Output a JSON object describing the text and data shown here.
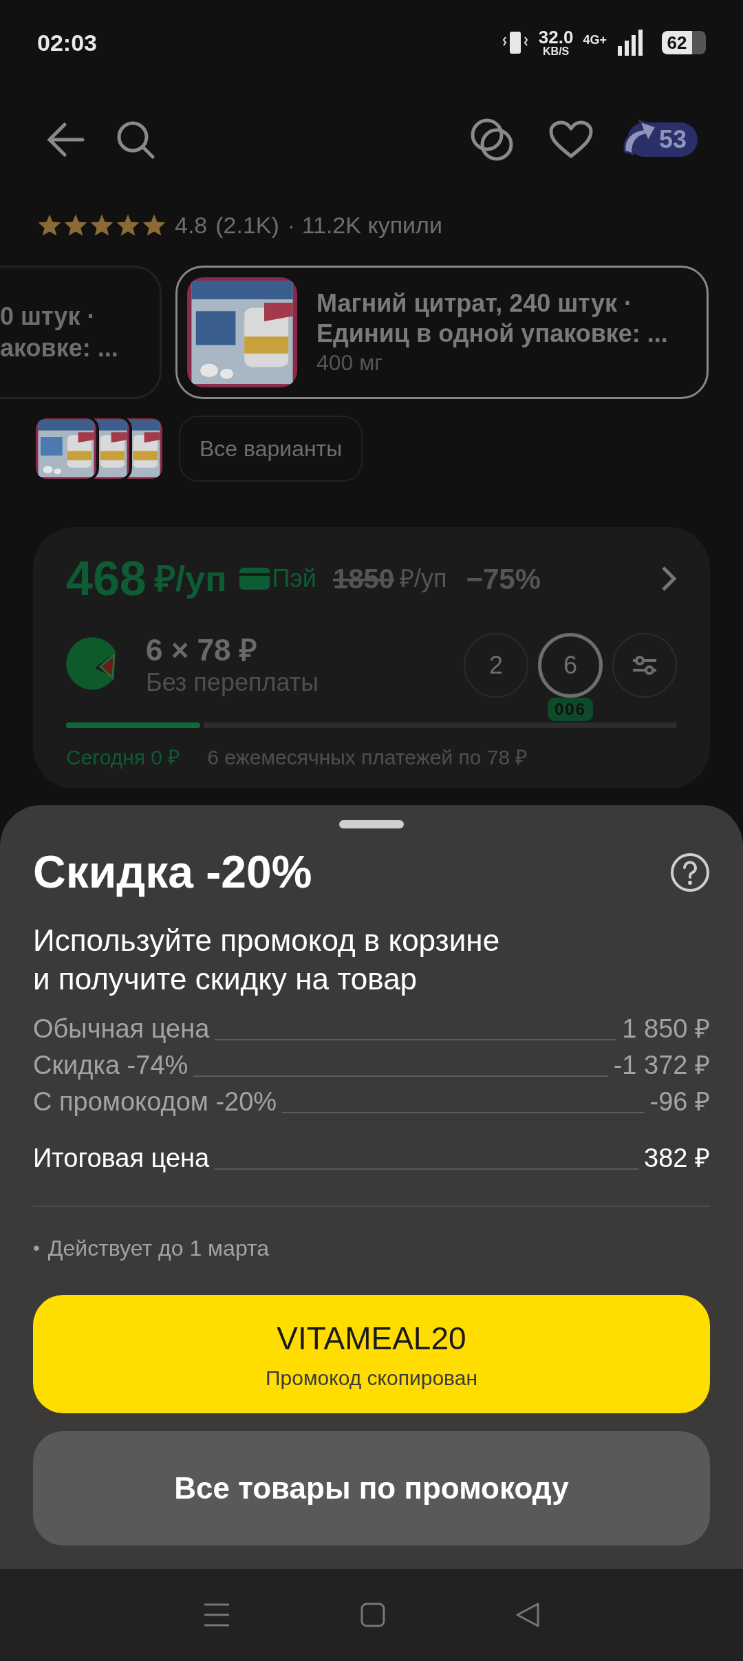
{
  "status_bar": {
    "time": "02:03",
    "speed": "32.0",
    "speed_unit": "KB/S",
    "network": "4G+",
    "battery": "62"
  },
  "toolbar": {
    "cashback": "53"
  },
  "rating": {
    "stars": 5,
    "score": "4.8",
    "reviews": "(2.1K)",
    "bought": "· 11.2K купили"
  },
  "variants": [
    {
      "title_lines": [
        "0 штук ·",
        "аковке: ..."
      ],
      "selected": false
    },
    {
      "title_lines": [
        "Магний цитрат, 240 штук ·",
        "Единиц в одной упаковке: ..."
      ],
      "subtitle": "400 мг",
      "selected": true
    }
  ],
  "all_variants": "Все варианты",
  "price_card": {
    "price": "468",
    "price_unit": "₽/уп",
    "pay_label": "Пэй",
    "old_price": "1850",
    "old_unit": "₽/уп",
    "discount": "−75%",
    "installment": "6 × 78 ₽",
    "installment_note": "Без переплаты",
    "terms": [
      {
        "label": "2",
        "selected": false
      },
      {
        "label": "6",
        "selected": true,
        "badge": "006"
      }
    ],
    "progress": {
      "level": 0.22,
      "today": "Сегодня 0 ₽",
      "rest": "6 ежемесячных платежей по 78 ₽"
    }
  },
  "sheet": {
    "title": "Скидка -20%",
    "description": "Используйте промокод в корзине\nи получите скидку на товар",
    "rows": [
      {
        "kind": "item",
        "label": "Обычная цена",
        "value": "1 850 ₽"
      },
      {
        "kind": "item",
        "label": "Скидка -74%",
        "value": "-1 372 ₽"
      },
      {
        "kind": "item",
        "label": "С промокодом -20%",
        "value": "-96 ₽"
      },
      {
        "kind": "total",
        "label": "Итоговая цена",
        "value": "382 ₽"
      }
    ],
    "notes": [
      {
        "bullet": "•",
        "text": "Действует до 1 марта"
      }
    ],
    "promo_button": {
      "code": "VITAMEAL20",
      "caption": "Промокод скопирован"
    },
    "secondary_button": "Все товары по промокоду"
  }
}
